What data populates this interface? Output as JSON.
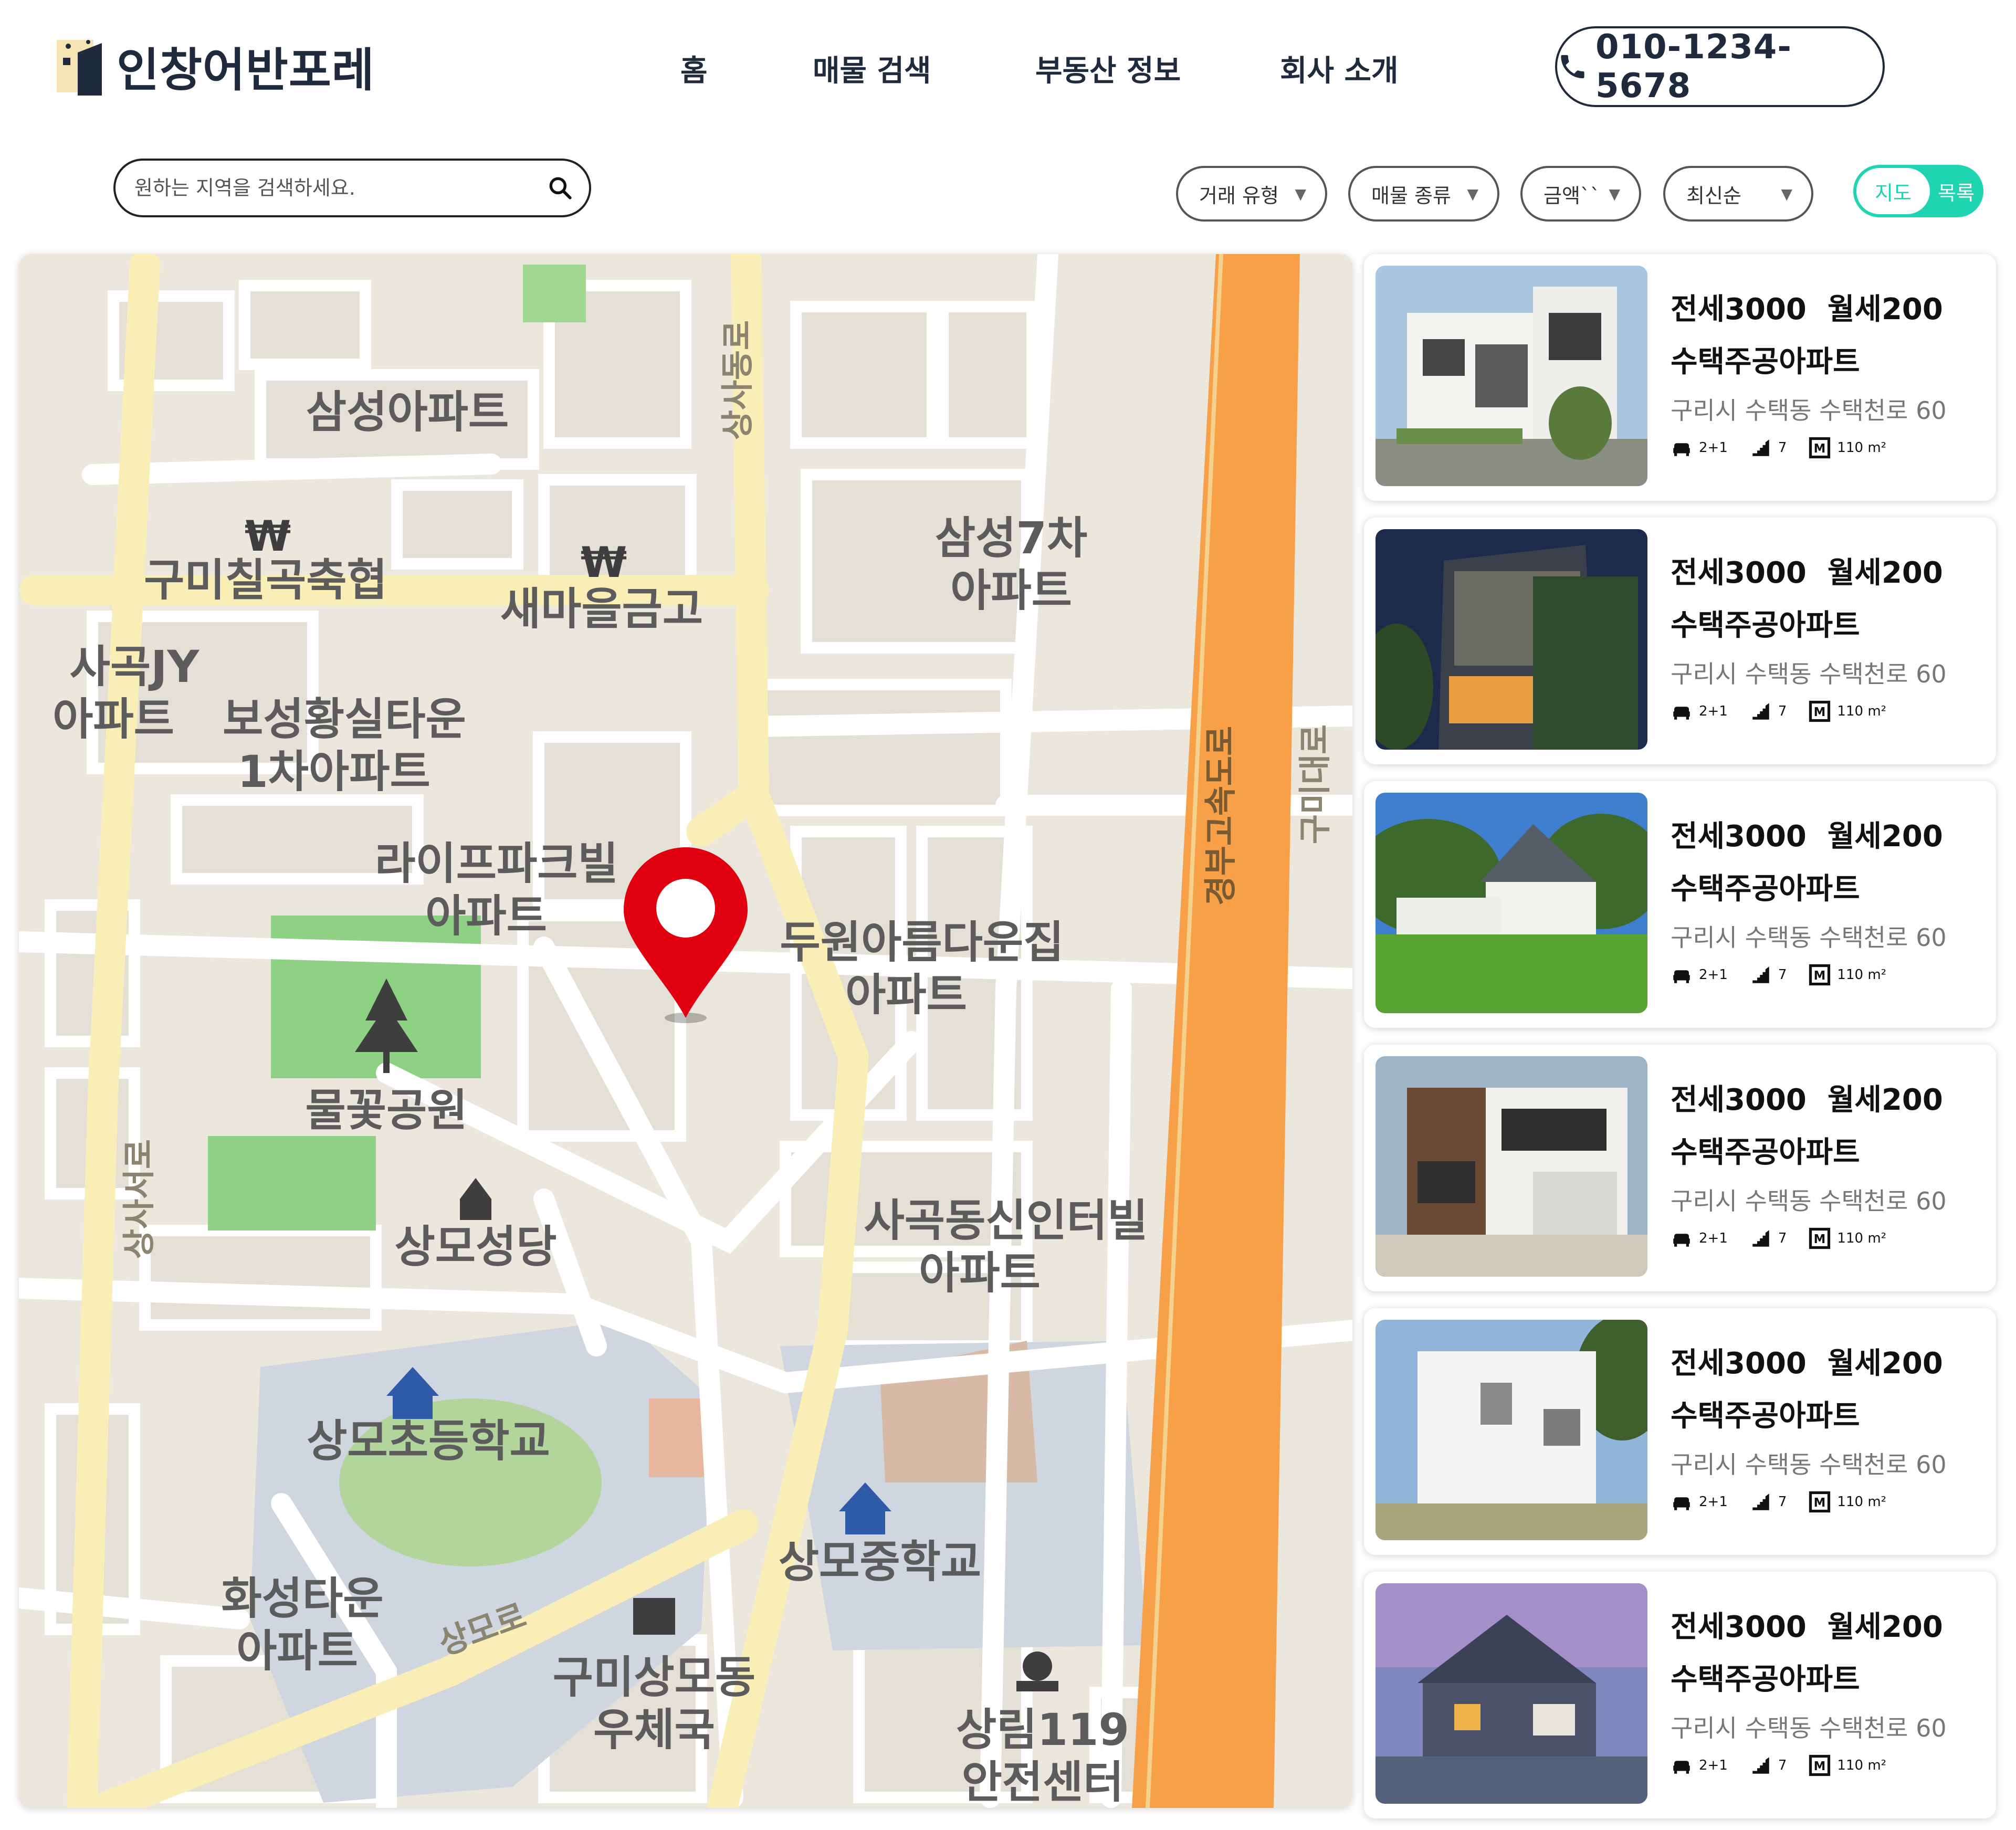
{
  "header": {
    "logo_text": "인창어반포레",
    "nav": [
      "홈",
      "매물 검색",
      "부동산 정보",
      "회사 소개"
    ],
    "phone": "010-1234-5678",
    "icons": {
      "logo": "building-logo-icon",
      "phone": "phone-icon"
    }
  },
  "search": {
    "placeholder": "원하는 지역을 검색하세요.",
    "icon": "search-icon"
  },
  "filters": [
    "거래 유형",
    "매물 종류",
    "금액``",
    "최신순"
  ],
  "view_toggle": {
    "map_label": "지도",
    "list_label": "목록",
    "active": "지도",
    "color": "#1fd4b0"
  },
  "map": {
    "labels": [
      "삼성아파트",
      "구미칠곡축협",
      "새마을금고",
      "삼성7차\n아파트",
      "사곡JY\n아파트",
      "보성황실타운\n1차아파트",
      "라이프파크빌\n아파트",
      "두원아름다운집\n아파트",
      "물꽃공원",
      "상모성당",
      "사곡동신인터빌\n아파트",
      "상모초등학교",
      "상모중학교",
      "화성타운\n아파트",
      "구미상모동\n우체국",
      "상림119\n안전센터"
    ],
    "road_labels": [
      "상사동로",
      "경부고속도로",
      "구미대로",
      "상사서로",
      "상모로"
    ],
    "marker_color": "#e0000f",
    "highway_color": "#f8a047"
  },
  "listings": [
    {
      "deposit": "전세3000",
      "rent": "월세200",
      "name": "수택주공아파트",
      "address": "구리시 수택동 수택천로 60",
      "rooms": "2+1",
      "floor": "7",
      "area": "110 m²"
    },
    {
      "deposit": "전세3000",
      "rent": "월세200",
      "name": "수택주공아파트",
      "address": "구리시 수택동 수택천로 60",
      "rooms": "2+1",
      "floor": "7",
      "area": "110 m²"
    },
    {
      "deposit": "전세3000",
      "rent": "월세200",
      "name": "수택주공아파트",
      "address": "구리시 수택동 수택천로 60",
      "rooms": "2+1",
      "floor": "7",
      "area": "110 m²"
    },
    {
      "deposit": "전세3000",
      "rent": "월세200",
      "name": "수택주공아파트",
      "address": "구리시 수택동 수택천로 60",
      "rooms": "2+1",
      "floor": "7",
      "area": "110 m²"
    },
    {
      "deposit": "전세3000",
      "rent": "월세200",
      "name": "수택주공아파트",
      "address": "구리시 수택동 수택천로 60",
      "rooms": "2+1",
      "floor": "7",
      "area": "110 m²"
    },
    {
      "deposit": "전세3000",
      "rent": "월세200",
      "name": "수택주공아파트",
      "address": "구리시 수택동 수택천로 60",
      "rooms": "2+1",
      "floor": "7",
      "area": "110 m²"
    }
  ]
}
